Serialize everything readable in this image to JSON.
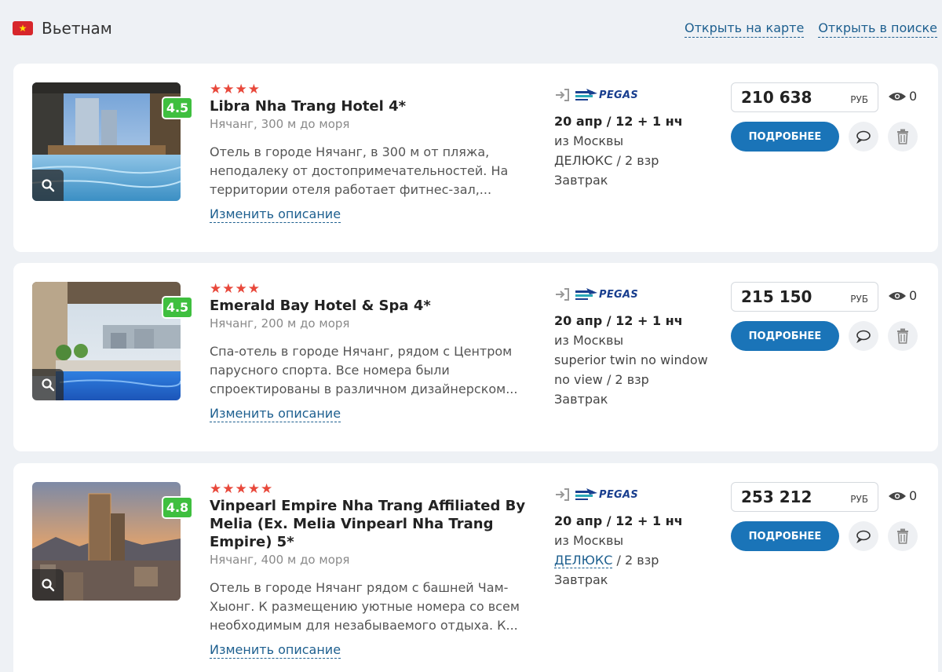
{
  "header": {
    "country": "Вьетнам",
    "links": [
      "Открыть на карте",
      "Открыть в поиске"
    ]
  },
  "hotels": [
    {
      "stars": "★★★★",
      "score": "4.5",
      "name": "Libra Nha Trang Hotel 4*",
      "location": "Нячанг, 300 м до моря",
      "description": "Отель в городе Нячанг, в 300 м от пляжа, неподалеку от достопримечательностей. На территории отеля работает фитнес-зал,...",
      "edit_label": "Изменить описание",
      "operator": "PEGAS",
      "dates": "20 апр / 12 + 1 нч",
      "from": "из Москвы",
      "room": "ДЕЛЮКС / 2 взр",
      "meal": "Завтрак",
      "price": "210 638",
      "currency": "РУБ",
      "views": "0",
      "more_label": "ПОДРОБНЕЕ"
    },
    {
      "stars": "★★★★",
      "score": "4.5",
      "name": "Emerald Bay Hotel & Spa 4*",
      "location": "Нячанг, 200 м до моря",
      "description": "Спа-отель в городе Нячанг, рядом с Центром парусного спорта. Все номера были спроектированы в различном дизайнерском...",
      "edit_label": "Изменить описание",
      "operator": "PEGAS",
      "dates": "20 апр / 12 + 1 нч",
      "from": "из Москвы",
      "room_line1": "superior twin no window",
      "room_line2": "no view / 2 взр",
      "meal": "Завтрак",
      "price": "215 150",
      "currency": "РУБ",
      "views": "0",
      "more_label": "ПОДРОБНЕЕ"
    },
    {
      "stars": "★★★★★",
      "score": "4.8",
      "name": "Vinpearl Empire Nha Trang Affiliated By Melia (Ex. Melia Vinpearl Nha Trang Empire) 5*",
      "location": "Нячанг, 400 м до моря",
      "description": "Отель в городе Нячанг рядом с башней Чам-Хыонг. К размещению уютные номера со всем необходимым для незабываемого отдыха. К...",
      "edit_label": "Изменить описание",
      "operator": "PEGAS",
      "dates": "20 апр / 12 + 1 нч",
      "from": "из Москвы",
      "room_link": "ДЕЛЮКС",
      "room_rest": " / 2 взр",
      "meal": "Завтрак",
      "price": "253 212",
      "currency": "РУБ",
      "views": "0",
      "more_label": "ПОДРОБНЕЕ"
    }
  ],
  "colors": {
    "accent": "#1a74b8",
    "stars": "#e8483b",
    "score": "#3fbf3f",
    "link": "#1d5f8f"
  }
}
